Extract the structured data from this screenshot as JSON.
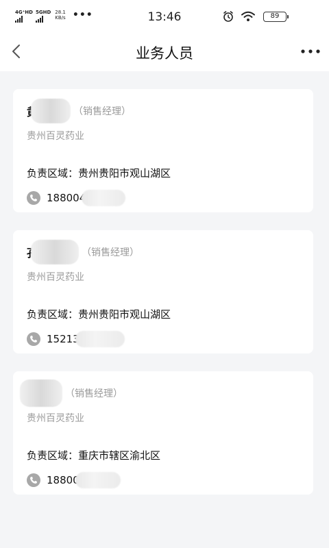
{
  "status_bar": {
    "network_1": "4G⁺HD",
    "network_2": "5GHD",
    "speed_value": "28.1",
    "speed_unit": "KB/s",
    "more_dots": "•••",
    "time": "13:46",
    "battery": "89"
  },
  "header": {
    "title": "业务人员"
  },
  "cards": [
    {
      "name": "黄",
      "role": "（销售经理）",
      "company": "贵州百灵药业",
      "region": "负责区域：贵州贵阳市观山湖区",
      "phone": "188004"
    },
    {
      "name": "孔",
      "role": "（销售经理）",
      "company": "贵州百灵药业",
      "region": "负责区域：贵州贵阳市观山湖区",
      "phone": "15213"
    },
    {
      "name": "",
      "role": "（销售经理）",
      "company": "贵州百灵药业",
      "region": "负责区域：重庆市辖区渝北区",
      "phone": "18800"
    }
  ]
}
